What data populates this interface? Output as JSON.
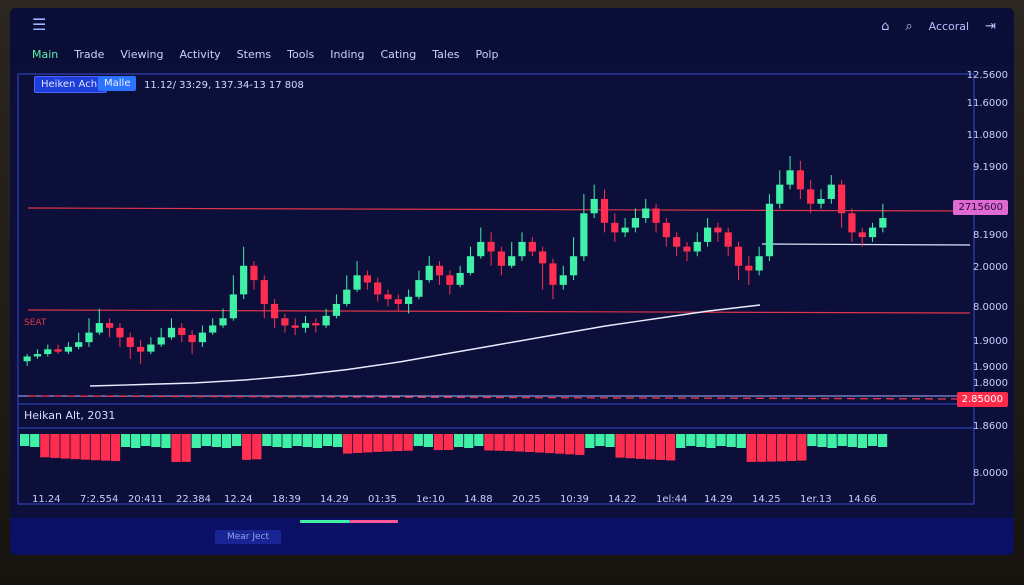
{
  "topbar": {
    "menu_icon": "hamburger-icon",
    "home_icon": "home-icon",
    "search_icon": "search-icon",
    "account_label": "Accoral",
    "logout_icon": "logout-icon"
  },
  "menu": [
    "Main",
    "Trade",
    "Viewing",
    "Activity",
    "Stems",
    "Tools",
    "Inding",
    "Cating",
    "Tales",
    "Polp"
  ],
  "chart_header": {
    "indicator_label": "Heiken Achi",
    "mode_label": "Malle",
    "info_text": "11.12/ 33:29, 137.34-13 17 808"
  },
  "y_axis": [
    "12.5600",
    "11.6000",
    "11.0800",
    "9.1900",
    "8.1900",
    "2.0000",
    "8.0000",
    "1.9000",
    "1.9000",
    "1.8000"
  ],
  "price_tags": {
    "upper": "2715600",
    "lower": "2.85000"
  },
  "sub_panel": {
    "label": "Heikan Alt, 2031",
    "y_labels": [
      "1.8600",
      "8.0000"
    ]
  },
  "left_label": "SEAT",
  "x_axis": [
    "11.24",
    "7:2.554",
    "20:411",
    "22.384",
    "12.24",
    "18:39",
    "14.29",
    "01:35",
    "1e:10",
    "14.88",
    "20.25",
    "10:39",
    "14.22",
    "1el:44",
    "14.29",
    "14.25",
    "1er.13",
    "14.66"
  ],
  "status_pill": "Mear Ject",
  "colors": {
    "bull": "#3ff0a6",
    "bear": "#ff2d4f",
    "bg": "#0b0f3a",
    "grid": "#3a49c8",
    "resistance": "#e0344a"
  },
  "chart_data": {
    "type": "candlestick",
    "candles": [
      [
        0.3,
        0.32,
        0.33,
        0.28
      ],
      [
        0.32,
        0.33,
        0.35,
        0.31
      ],
      [
        0.33,
        0.35,
        0.37,
        0.32
      ],
      [
        0.35,
        0.34,
        0.37,
        0.33
      ],
      [
        0.34,
        0.36,
        0.38,
        0.33
      ],
      [
        0.36,
        0.38,
        0.42,
        0.35
      ],
      [
        0.38,
        0.42,
        0.48,
        0.36
      ],
      [
        0.42,
        0.46,
        0.52,
        0.41
      ],
      [
        0.46,
        0.44,
        0.48,
        0.4
      ],
      [
        0.44,
        0.4,
        0.46,
        0.36
      ],
      [
        0.4,
        0.36,
        0.42,
        0.31
      ],
      [
        0.36,
        0.34,
        0.39,
        0.29
      ],
      [
        0.34,
        0.37,
        0.4,
        0.33
      ],
      [
        0.37,
        0.4,
        0.44,
        0.36
      ],
      [
        0.4,
        0.44,
        0.48,
        0.39
      ],
      [
        0.44,
        0.41,
        0.46,
        0.38
      ],
      [
        0.41,
        0.38,
        0.43,
        0.33
      ],
      [
        0.38,
        0.42,
        0.45,
        0.36
      ],
      [
        0.42,
        0.45,
        0.48,
        0.41
      ],
      [
        0.45,
        0.48,
        0.52,
        0.44
      ],
      [
        0.48,
        0.58,
        0.66,
        0.47
      ],
      [
        0.58,
        0.7,
        0.78,
        0.56
      ],
      [
        0.7,
        0.64,
        0.72,
        0.6
      ],
      [
        0.64,
        0.54,
        0.66,
        0.48
      ],
      [
        0.54,
        0.48,
        0.56,
        0.44
      ],
      [
        0.48,
        0.45,
        0.5,
        0.42
      ],
      [
        0.45,
        0.44,
        0.48,
        0.41
      ],
      [
        0.44,
        0.46,
        0.49,
        0.42
      ],
      [
        0.46,
        0.45,
        0.48,
        0.42
      ],
      [
        0.45,
        0.49,
        0.52,
        0.44
      ],
      [
        0.49,
        0.54,
        0.58,
        0.48
      ],
      [
        0.54,
        0.6,
        0.66,
        0.53
      ],
      [
        0.6,
        0.66,
        0.72,
        0.59
      ],
      [
        0.66,
        0.63,
        0.68,
        0.6
      ],
      [
        0.63,
        0.58,
        0.65,
        0.55
      ],
      [
        0.58,
        0.56,
        0.6,
        0.53
      ],
      [
        0.56,
        0.54,
        0.58,
        0.51
      ],
      [
        0.54,
        0.57,
        0.6,
        0.5
      ],
      [
        0.57,
        0.64,
        0.68,
        0.56
      ],
      [
        0.64,
        0.7,
        0.74,
        0.63
      ],
      [
        0.7,
        0.66,
        0.72,
        0.62
      ],
      [
        0.66,
        0.62,
        0.68,
        0.58
      ],
      [
        0.62,
        0.67,
        0.7,
        0.61
      ],
      [
        0.67,
        0.74,
        0.78,
        0.66
      ],
      [
        0.74,
        0.8,
        0.86,
        0.73
      ],
      [
        0.8,
        0.76,
        0.84,
        0.7
      ],
      [
        0.76,
        0.7,
        0.78,
        0.66
      ],
      [
        0.7,
        0.74,
        0.8,
        0.69
      ],
      [
        0.74,
        0.8,
        0.84,
        0.72
      ],
      [
        0.8,
        0.76,
        0.82,
        0.74
      ],
      [
        0.76,
        0.71,
        0.78,
        0.6
      ],
      [
        0.71,
        0.62,
        0.73,
        0.56
      ],
      [
        0.62,
        0.66,
        0.7,
        0.6
      ],
      [
        0.66,
        0.74,
        0.82,
        0.64
      ],
      [
        0.74,
        0.92,
        1.0,
        0.72
      ],
      [
        0.92,
        0.98,
        1.04,
        0.9
      ],
      [
        0.98,
        0.88,
        1.02,
        0.84
      ],
      [
        0.88,
        0.84,
        0.92,
        0.8
      ],
      [
        0.84,
        0.86,
        0.9,
        0.82
      ],
      [
        0.86,
        0.9,
        0.94,
        0.84
      ],
      [
        0.9,
        0.94,
        0.98,
        0.88
      ],
      [
        0.94,
        0.88,
        0.96,
        0.84
      ],
      [
        0.88,
        0.82,
        0.9,
        0.78
      ],
      [
        0.82,
        0.78,
        0.84,
        0.74
      ],
      [
        0.78,
        0.76,
        0.8,
        0.72
      ],
      [
        0.76,
        0.8,
        0.84,
        0.74
      ],
      [
        0.8,
        0.86,
        0.9,
        0.78
      ],
      [
        0.86,
        0.84,
        0.88,
        0.8
      ],
      [
        0.84,
        0.78,
        0.86,
        0.74
      ],
      [
        0.78,
        0.7,
        0.8,
        0.64
      ],
      [
        0.7,
        0.68,
        0.74,
        0.62
      ],
      [
        0.68,
        0.74,
        0.78,
        0.66
      ],
      [
        0.74,
        0.96,
        1.0,
        0.72
      ],
      [
        0.96,
        1.04,
        1.1,
        0.94
      ],
      [
        1.04,
        1.1,
        1.16,
        1.02
      ],
      [
        1.1,
        1.02,
        1.14,
        0.98
      ],
      [
        1.02,
        0.96,
        1.06,
        0.92
      ],
      [
        0.96,
        0.98,
        1.02,
        0.94
      ],
      [
        0.98,
        1.04,
        1.08,
        0.96
      ],
      [
        1.04,
        0.92,
        1.06,
        0.86
      ],
      [
        0.92,
        0.84,
        0.94,
        0.8
      ],
      [
        0.84,
        0.82,
        0.86,
        0.78
      ],
      [
        0.82,
        0.86,
        0.88,
        0.8
      ],
      [
        0.86,
        0.9,
        0.96,
        0.84
      ]
    ],
    "moving_average": [
      0.04,
      0.045,
      0.05,
      0.06,
      0.075,
      0.095,
      0.12,
      0.15,
      0.18,
      0.21,
      0.24,
      0.265,
      0.29,
      0.31
    ],
    "oscillator": [
      1,
      1,
      -1,
      -1,
      -1,
      -1,
      -1,
      -1,
      -1,
      -1,
      1,
      1,
      1,
      1,
      1,
      -1,
      -1,
      1,
      1,
      1,
      1,
      1,
      -1,
      -1,
      1,
      1,
      1,
      1,
      1,
      1,
      1,
      1,
      -1,
      -1,
      -1,
      -1,
      -1,
      -1,
      -1,
      1,
      1,
      -1,
      -1,
      1,
      1,
      1,
      -1,
      -1,
      -1,
      -1,
      -1,
      -1,
      -1,
      -1,
      -1,
      -1,
      1,
      1,
      1,
      -1,
      -1,
      -1,
      -1,
      -1,
      -1,
      1,
      1,
      1,
      1,
      1,
      1,
      1,
      -1,
      -1,
      -1,
      -1,
      -1,
      -1,
      1,
      1,
      1,
      1,
      1,
      1,
      1,
      1
    ]
  }
}
